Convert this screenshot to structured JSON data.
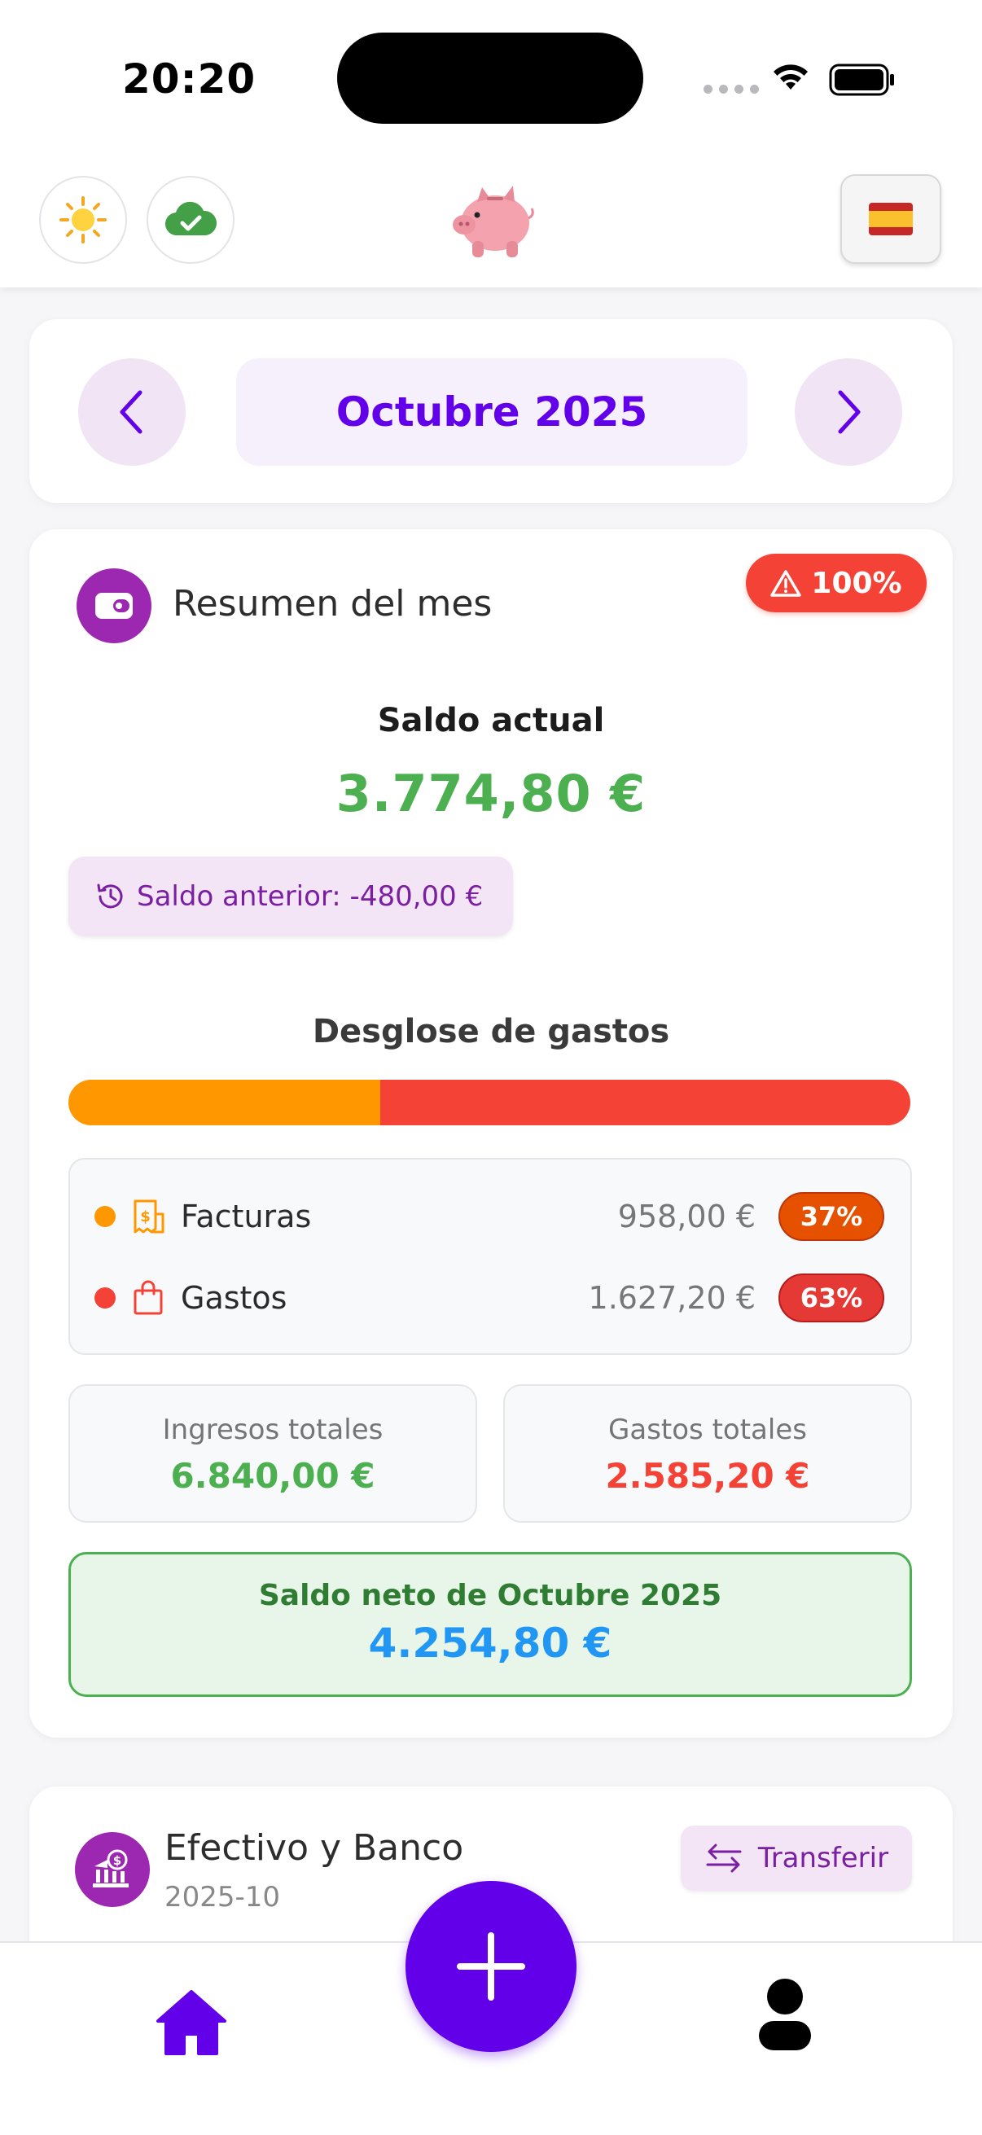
{
  "status_bar": {
    "time": "20:20"
  },
  "header": {
    "theme_icon": "sun-icon",
    "sync_icon": "cloud-check-icon",
    "logo_icon": "piggy-bank-icon",
    "language_icon": "spain-flag-icon"
  },
  "month_selector": {
    "label": "Octubre 2025",
    "prev_icon": "chevron-left-icon",
    "next_icon": "chevron-right-icon"
  },
  "summary": {
    "title": "Resumen del mes",
    "alert_badge": "100%",
    "balance_label": "Saldo actual",
    "balance_value": "3.774,80 €",
    "previous_balance": "Saldo anterior: -480,00 €",
    "breakdown_title": "Desglose de gastos",
    "breakdown_fraction": 0.37,
    "breakdown": [
      {
        "label": "Facturas",
        "amount": "958,00 €",
        "percent": "37%",
        "color": "#ff9800",
        "badge_color": "#e65100"
      },
      {
        "label": "Gastos",
        "amount": "1.627,20 €",
        "percent": "63%",
        "color": "#f44336",
        "badge_color": "#e53935"
      }
    ],
    "total_income_label": "Ingresos totales",
    "total_income_value": "6.840,00 €",
    "total_expenses_label": "Gastos totales",
    "total_expenses_value": "2.585,20 €",
    "net_label": "Saldo neto de Octubre 2025",
    "net_value": "4.254,80 €"
  },
  "cash_bank": {
    "title": "Efectivo y Banco",
    "date": "2025-10",
    "transfer_label": "Transferir"
  },
  "colors": {
    "accent": "#6200ea",
    "purple": "#9c27b0",
    "positive": "#4caf50",
    "negative": "#f44336",
    "net": "#2196f3"
  },
  "tabbar": {
    "home_icon": "home-icon",
    "add_icon": "plus-icon",
    "profile_icon": "user-icon"
  }
}
